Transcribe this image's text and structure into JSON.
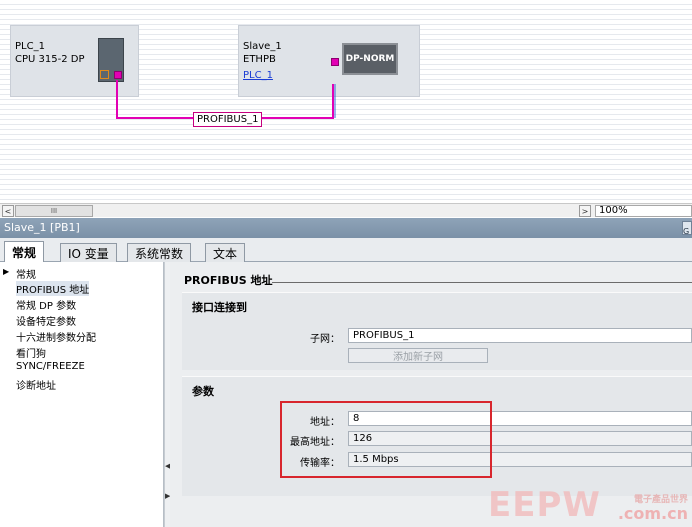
{
  "network": {
    "plc": {
      "name": "PLC_1",
      "type": "CPU 315-2 DP"
    },
    "slave": {
      "name": "Slave_1",
      "type": "ETHPB",
      "link": "PLC_1",
      "module": "DP-NORM"
    },
    "subnet_label": "PROFIBUS_1",
    "colors": {
      "profibus": "#e200b4",
      "profinet": "#3a64d8"
    }
  },
  "scrollbar": {
    "left_arrow": "<",
    "thumb_grip": "III",
    "right_arrow": ">",
    "zoom": "100%"
  },
  "panel": {
    "title": "Slave_1 [PB1]",
    "title_button": "G",
    "tabs": [
      "常规",
      "IO 变量",
      "系统常数",
      "文本"
    ],
    "nav": {
      "root": "常规",
      "items": [
        "PROFIBUS 地址",
        "常规 DP 参数",
        "设备特定参数",
        "十六进制参数分配",
        "看门狗",
        "SYNC/FREEZE",
        "诊断地址"
      ]
    },
    "section_title": "PROFIBUS 地址",
    "interface": {
      "title": "接口连接到",
      "subnet_label": "子网：",
      "subnet_value": "PROFIBUS_1",
      "add_subnet": "添加新子网"
    },
    "params": {
      "title": "参数",
      "address_label": "地址：",
      "address_value": "8",
      "max_address_label": "最高地址：",
      "max_address_value": "126",
      "baud_label": "传输率：",
      "baud_value": "1.5 Mbps"
    }
  },
  "watermark": {
    "logo": "EEPW",
    "sub": "電子產品世界",
    "com": ".com.cn"
  }
}
